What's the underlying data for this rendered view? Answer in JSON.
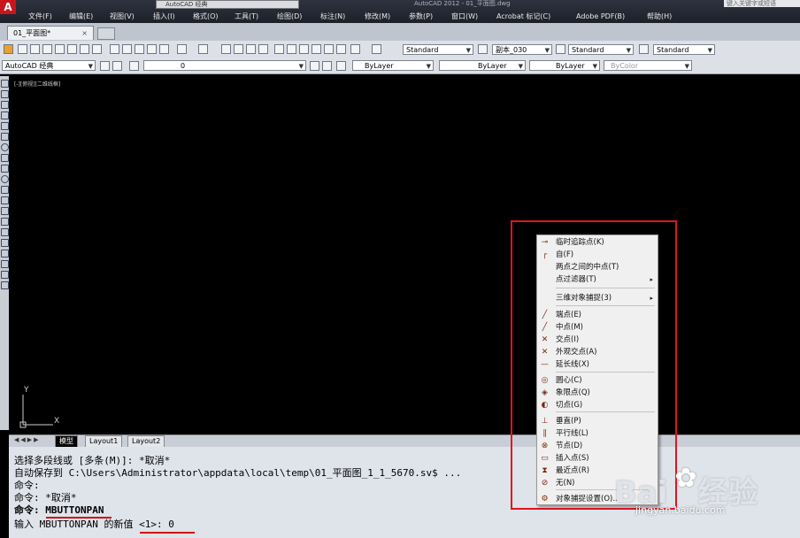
{
  "title_bar": {
    "logo": "A",
    "workspace": "AutoCAD 经典",
    "title": "AutoCAD 2012 - 01_平面图.dwg",
    "search_placeholder": "键入关键字或短语"
  },
  "menu": [
    {
      "label": "文件(F)"
    },
    {
      "label": "编辑(E)"
    },
    {
      "label": "视图(V)"
    },
    {
      "label": "插入(I)"
    },
    {
      "label": "格式(O)"
    },
    {
      "label": "工具(T)"
    },
    {
      "label": "绘图(D)"
    },
    {
      "label": "标注(N)"
    },
    {
      "label": "修改(M)"
    },
    {
      "label": "参数(P)"
    },
    {
      "label": "窗口(W)"
    },
    {
      "label": "Acrobat 标记(C)"
    },
    {
      "label": "Adobe PDF(B)"
    },
    {
      "label": "帮助(H)"
    }
  ],
  "tabs": {
    "active": "01_平面图*",
    "close": "×"
  },
  "toolbar1": {
    "text_style": "Standard",
    "dim_style": "副本_030",
    "table_style": "Standard",
    "multileader_style": "Standard"
  },
  "toolbar2": {
    "workspace": "AutoCAD 经典",
    "layer": "0",
    "color": "ByLayer",
    "linetype": "ByLayer",
    "lineweight": "ByLayer",
    "plot_style": "ByColor"
  },
  "viewport_label": "[-][俯视][二维线框]",
  "ucs": {
    "y": "Y",
    "x": "X"
  },
  "layout_tabs": [
    "模型",
    "Layout1",
    "Layout2"
  ],
  "command_lines": [
    "选择多段线或 [多条(M)]: *取消*",
    "自动保存到 C:\\Users\\Administrator\\appdata\\local\\temp\\01_平面图_1_1_5670.sv$ ...",
    "命令:",
    "命令: *取消*",
    "命令: MBUTTONPAN",
    "输入 MBUTTONPAN 的新值 <1>: 0"
  ],
  "context_menu": [
    {
      "icon": "temp-track-icon",
      "glyph": "⊸",
      "label": "临时追踪点(K)"
    },
    {
      "icon": "from-icon",
      "glyph": "┌",
      "label": "自(F)"
    },
    {
      "icon": "none",
      "glyph": "",
      "label": "两点之间的中点(T)"
    },
    {
      "icon": "none",
      "glyph": "",
      "label": "点过滤器(T)",
      "submenu": "▸"
    },
    {
      "icon": "none",
      "glyph": "",
      "label": "三维对象捕捉(3)",
      "submenu": "▸"
    },
    {
      "icon": "endpoint-icon",
      "glyph": "╱",
      "label": "端点(E)"
    },
    {
      "icon": "midpoint-icon",
      "glyph": "╱",
      "label": "中点(M)"
    },
    {
      "icon": "intersection-icon",
      "glyph": "✕",
      "label": "交点(I)"
    },
    {
      "icon": "apparent-intersection-icon",
      "glyph": "✕",
      "label": "外观交点(A)"
    },
    {
      "icon": "extension-icon",
      "glyph": "—",
      "label": "延长线(X)"
    },
    {
      "icon": "center-icon",
      "glyph": "◎",
      "label": "圆心(C)"
    },
    {
      "icon": "quadrant-icon",
      "glyph": "◈",
      "label": "象限点(Q)"
    },
    {
      "icon": "tangent-icon",
      "glyph": "◐",
      "label": "切点(G)"
    },
    {
      "icon": "perpendicular-icon",
      "glyph": "⊥",
      "label": "垂直(P)"
    },
    {
      "icon": "parallel-icon",
      "glyph": "∥",
      "label": "平行线(L)"
    },
    {
      "icon": "node-icon",
      "glyph": "⊗",
      "label": "节点(D)"
    },
    {
      "icon": "insert-icon",
      "glyph": "▭",
      "label": "插入点(S)"
    },
    {
      "icon": "nearest-icon",
      "glyph": "⧗",
      "label": "最近点(R)"
    },
    {
      "icon": "none-snap-icon",
      "glyph": "⊘",
      "label": "无(N)"
    },
    {
      "icon": "osnap-settings-icon",
      "glyph": "⚙",
      "label": "对象捕捉设置(O)..."
    }
  ],
  "watermark": {
    "logo_left": "Bai",
    "logo_right": "经验",
    "paw": "✿",
    "url": "jingyan.baidu.com"
  },
  "colors": {
    "highlight": "#e0141e",
    "underline": "#d01010",
    "canvas": "#000000"
  }
}
